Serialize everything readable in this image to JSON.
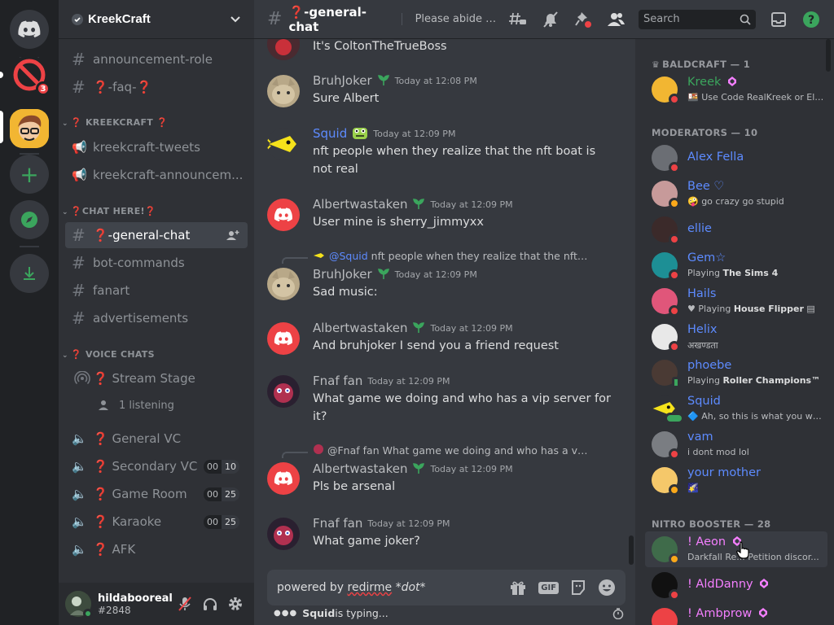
{
  "colors": {
    "online": "#3ba55d",
    "dnd": "#ed4245",
    "idle": "#faa81a",
    "mobile": "#3ba55d",
    "accent": "#5865f2",
    "mod_name": "#5d8bff",
    "booster_name": "#f47fff",
    "owner_name": "#3ba55d"
  },
  "rail": {
    "mention_count": "3"
  },
  "guild": {
    "name": "KreekCraft"
  },
  "channels": {
    "announcement_role": "announcement-role",
    "faq": "❓-faq-❓",
    "cat_kreekcraft": "❓ KREEKCRAFT ❓",
    "kreekcraft_tweets": "kreekcraft-tweets",
    "kreekcraft_announcements": "kreekcraft-announcem...",
    "cat_chat_here": "❓CHAT HERE!❓",
    "general_chat": "❓-general-chat",
    "bot_commands": "bot-commands",
    "fanart": "fanart",
    "advertisements": "advertisements",
    "cat_voice": "❓ VOICE CHATS",
    "stream_stage": "❓ Stream Stage",
    "listening": "1 listening",
    "general_vc": "❓ General VC",
    "secondary_vc": "❓ Secondary VC",
    "secondary_vc_count": "00",
    "secondary_vc_limit": "10",
    "game_room": "❓ Game Room",
    "game_room_count": "00",
    "game_room_limit": "25",
    "karaoke": "❓ Karaoke",
    "karaoke_count": "00",
    "karaoke_limit": "25",
    "afk": "❓ AFK"
  },
  "user": {
    "name": "hildabooreal",
    "tag": "#2848"
  },
  "header": {
    "channel": "❓-general-chat",
    "topic": "Please abide by the rules",
    "search_placeholder": "Search"
  },
  "messages": {
    "m0_text": "It's ColtonTheTrueBoss",
    "m1_author": "BruhJoker",
    "m1_time": "Today at 12:08 PM",
    "m1_text": "Sure Albert",
    "m2_author": "Squid",
    "m2_time": "Today at 12:09 PM",
    "m2_text": "nft people when they realize that the nft boat is not real",
    "m3_author": "Albertwastaken",
    "m3_time": "Today at 12:09 PM",
    "m3_text": "User mine is sherry_jimmyxx",
    "m4_reply_author": "@Squid",
    "m4_reply_text": "nft people when they realize that the nft boa...",
    "m4_author": "BruhJoker",
    "m4_time": "Today at 12:09 PM",
    "m4_text": "Sad music:",
    "m5_author": "Albertwastaken",
    "m5_time": "Today at 12:09 PM",
    "m5_text": "And bruhjoker I send you a friend request",
    "m6_author": "Fnaf fan",
    "m6_time": "Today at 12:09 PM",
    "m6_text": "What game we doing and who has a vip server for it?",
    "m7_reply_author": "@Fnaf fan",
    "m7_reply_text": "What game we doing and who has a vip s...",
    "m7_author": "Albertwastaken",
    "m7_time": "Today at 12:09 PM",
    "m7_text": "Pls be arsenal",
    "m8_author": "Fnaf fan",
    "m8_time": "Today at 12:09 PM",
    "m8_text": "What game joker?"
  },
  "composer": {
    "text_prefix": "powered by ",
    "text_link": "redirme",
    "text_suffix": " *dot*",
    "gif": "GIF"
  },
  "typing": {
    "user": "Squid",
    "suffix": " is typing..."
  },
  "members": {
    "g1": "BALDCRAFT — 1",
    "kreek_name": "Kreek",
    "kreek_status": "Use Code RealKreek or Else",
    "g2": "MODERATORS — 10",
    "alex_name": "Alex Fella",
    "bee_name": "Bee ♡",
    "bee_status": "go crazy go stupid",
    "ellie_name": "ellie",
    "gem_name": "Gem☆",
    "gem_status_prefix": "Playing ",
    "gem_status_game": "The Sims 4",
    "hails_name": "Hails",
    "hails_status_prefix": "Playing ",
    "hails_status_game": "House Flipper",
    "helix_name": "Helix",
    "helix_status": "अखण्डता",
    "phoebe_name": "phoebe",
    "phoebe_status_prefix": "Playing ",
    "phoebe_status_game": "Roller Champions™",
    "squid_name": "Squid",
    "squid_status": "Ah, so this is what you war...",
    "vam_name": "vam",
    "vam_status": "i dont mod lol",
    "mother_name": "your mother",
    "g3": "NITRO BOOSTER — 28",
    "aeon_name": "! Aeon",
    "aeon_status": "Darkfall Re... Petition discor...",
    "alddanny_name": "! AldDanny",
    "ambprow_name": "! Ambprow"
  }
}
